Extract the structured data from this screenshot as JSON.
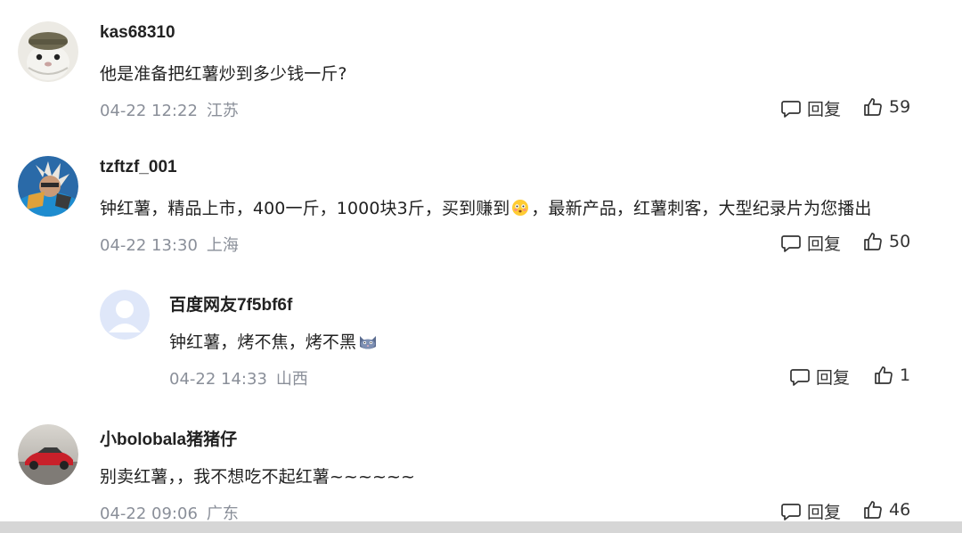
{
  "comments": [
    {
      "username": "kas68310",
      "text": "他是准备把红薯炒到多少钱一斤?",
      "date": "04-22 12:22",
      "location": "江苏",
      "reply_label": "回复",
      "likes": "59",
      "avatar": "hamster-avatar"
    },
    {
      "username": "tzftzf_001",
      "text_before": "钟红薯，精品上市，400一斤，1000块3斤，买到赚到",
      "emoji": "flushed-face-emoji",
      "text_after": "，最新产品，红薯刺客，大型纪录片为您播出",
      "date": "04-22 13:30",
      "location": "上海",
      "reply_label": "回复",
      "likes": "50",
      "avatar": "anime-character-avatar"
    },
    {
      "username": "百度网友7f5bf6f",
      "text": "钟红薯，烤不焦，烤不黑",
      "emoji": "cat-face-emoji",
      "date": "04-22 14:33",
      "location": "山西",
      "reply_label": "回复",
      "likes": "1",
      "avatar": "default-avatar"
    },
    {
      "username": "小bolobala猪猪仔",
      "text": "别卖红薯，，我不想吃不起红薯~~~~~~",
      "date": "04-22 09:06",
      "location": "广东",
      "reply_label": "回复",
      "likes": "46",
      "avatar": "red-sports-car-avatar"
    }
  ]
}
